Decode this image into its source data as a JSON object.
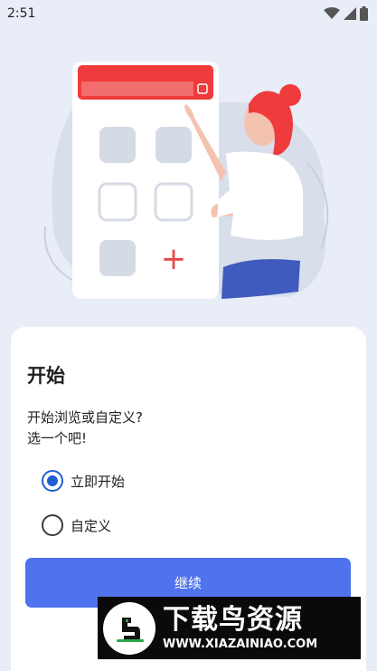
{
  "status_bar": {
    "time": "2:51",
    "icons": [
      "wifi-icon",
      "cell-signal-icon",
      "battery-icon"
    ]
  },
  "illustration": {
    "description_icon": "person-with-calculator-illustration",
    "plus_glyph": "+"
  },
  "card": {
    "title": "开始",
    "prompt_line1": "开始浏览或自定义?",
    "prompt_line2": "选一个吧!",
    "options": [
      {
        "label": "立即开始",
        "selected": true
      },
      {
        "label": "自定义",
        "selected": false
      }
    ],
    "continue_label": "继续"
  },
  "watermark": {
    "title": "下载鸟资源",
    "url": "WWW.XIAZAINIAO.COM"
  },
  "colors": {
    "background": "#e8edf7",
    "accent": "#4e73ec",
    "radio_selected": "#1f5fd1",
    "header_red": "#ef3b3b"
  }
}
